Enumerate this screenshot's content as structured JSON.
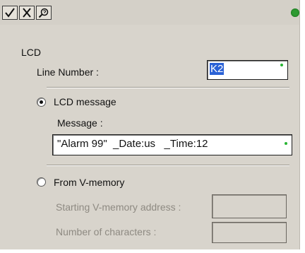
{
  "toolbar": {
    "buttons": [
      {
        "name": "check-button",
        "icon": "check-icon"
      },
      {
        "name": "cancel-button",
        "icon": "x-icon"
      },
      {
        "name": "help-button",
        "icon": "help-magnifier-icon"
      }
    ],
    "status_color": "#2e9a32"
  },
  "section": {
    "title": "LCD"
  },
  "line_number": {
    "label": "Line Number :",
    "value": "K2"
  },
  "lcd_message": {
    "option_label": "LCD message",
    "selected": true,
    "message_label": "Message :",
    "message_value": "\"Alarm 99\"  _Date:us   _Time:12"
  },
  "v_memory": {
    "option_label": "From V-memory",
    "selected": false,
    "start_address_label": "Starting V-memory address :",
    "start_address_value": "",
    "num_chars_label": "Number of characters :",
    "num_chars_value": ""
  },
  "colors": {
    "panel": "#d8d4cc",
    "selection": "#2b62d6",
    "indicator": "#28b533"
  }
}
